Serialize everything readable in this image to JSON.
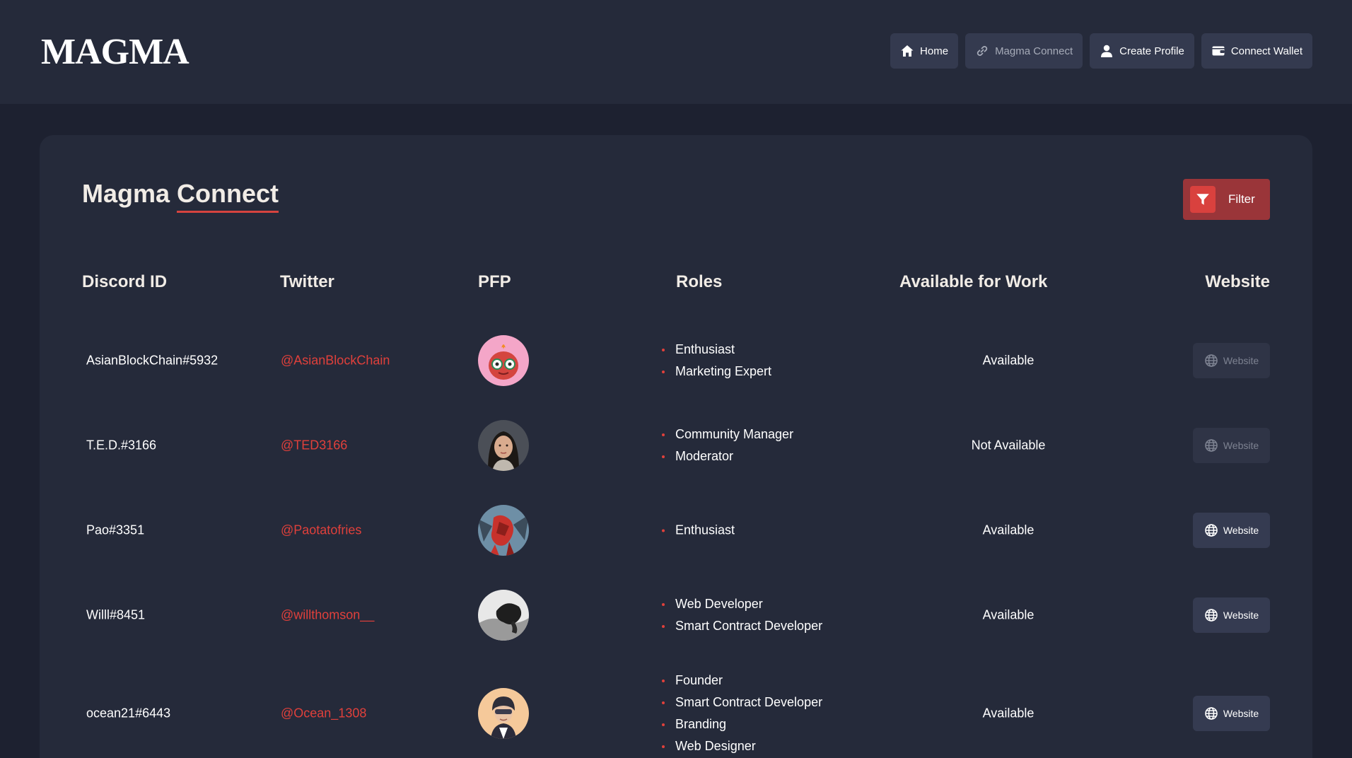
{
  "app": {
    "logo": "MAGMA"
  },
  "nav": {
    "home": "Home",
    "magma_connect": "Magma Connect",
    "create_profile": "Create Profile",
    "connect_wallet": "Connect Wallet"
  },
  "page": {
    "title_part1": "Magma",
    "title_part2": "Connect",
    "filter_label": "Filter"
  },
  "table": {
    "headers": {
      "discord": "Discord ID",
      "twitter": "Twitter",
      "pfp": "PFP",
      "roles": "Roles",
      "available": "Available for Work",
      "website": "Website"
    },
    "rows": [
      {
        "discord": "AsianBlockChain#5932",
        "twitter": "@AsianBlockChain",
        "roles": [
          "Enthusiast",
          "Marketing Expert"
        ],
        "availability": "Available",
        "website_label": "Website",
        "website_enabled": false
      },
      {
        "discord": "T.E.D.#3166",
        "twitter": "@TED3166",
        "roles": [
          "Community Manager",
          "Moderator"
        ],
        "availability": "Not Available",
        "website_label": "Website",
        "website_enabled": false
      },
      {
        "discord": "Pao#3351",
        "twitter": "@Paotatofries",
        "roles": [
          "Enthusiast"
        ],
        "availability": "Available",
        "website_label": "Website",
        "website_enabled": true
      },
      {
        "discord": "Willl#8451",
        "twitter": "@willthomson__",
        "roles": [
          "Web Developer",
          "Smart Contract Developer"
        ],
        "availability": "Available",
        "website_label": "Website",
        "website_enabled": true
      },
      {
        "discord": "ocean21#6443",
        "twitter": "@Ocean_1308",
        "roles": [
          "Founder",
          "Smart Contract Developer",
          "Branding",
          "Web Designer"
        ],
        "availability": "Available",
        "website_label": "Website",
        "website_enabled": true
      }
    ]
  },
  "icons": {
    "home": "home-icon",
    "magma_connect": "link-icon",
    "create_profile": "user-icon",
    "connect_wallet": "wallet-icon",
    "filter": "funnel-icon",
    "website": "globe-icon"
  },
  "colors": {
    "background": "#1d2130",
    "panel": "#252a3a",
    "accent": "#e0403b",
    "filter_button": "#9a3539"
  }
}
